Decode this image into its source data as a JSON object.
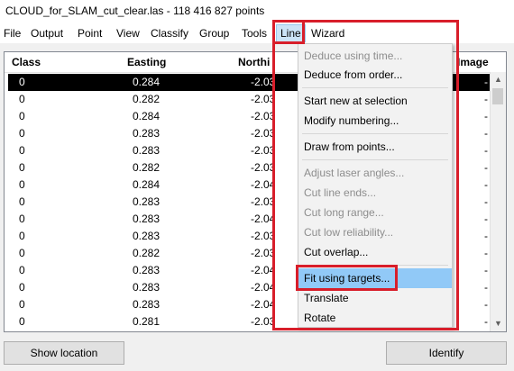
{
  "window": {
    "title": "CLOUD_for_SLAM_cut_clear.las - 118 416 827 points"
  },
  "menubar": [
    "File",
    "Output",
    "Point",
    "View",
    "Classify",
    "Group",
    "Tools",
    "Line",
    "Wizard"
  ],
  "table": {
    "columns": [
      "Class",
      "Easting",
      "Northi",
      "Image"
    ],
    "rows": [
      {
        "class": "0",
        "easting": "0.284",
        "northing": "-2.03",
        "image": "-"
      },
      {
        "class": "0",
        "easting": "0.282",
        "northing": "-2.03",
        "image": "-"
      },
      {
        "class": "0",
        "easting": "0.284",
        "northing": "-2.03",
        "image": "-"
      },
      {
        "class": "0",
        "easting": "0.283",
        "northing": "-2.03",
        "image": "-"
      },
      {
        "class": "0",
        "easting": "0.283",
        "northing": "-2.03",
        "image": "-"
      },
      {
        "class": "0",
        "easting": "0.282",
        "northing": "-2.03",
        "image": "-"
      },
      {
        "class": "0",
        "easting": "0.284",
        "northing": "-2.04",
        "image": "-"
      },
      {
        "class": "0",
        "easting": "0.283",
        "northing": "-2.03",
        "image": "-"
      },
      {
        "class": "0",
        "easting": "0.283",
        "northing": "-2.04",
        "image": "-"
      },
      {
        "class": "0",
        "easting": "0.283",
        "northing": "-2.03",
        "image": "-"
      },
      {
        "class": "0",
        "easting": "0.282",
        "northing": "-2.03",
        "image": "-"
      },
      {
        "class": "0",
        "easting": "0.283",
        "northing": "-2.04",
        "image": "-"
      },
      {
        "class": "0",
        "easting": "0.283",
        "northing": "-2.04",
        "image": "-"
      },
      {
        "class": "0",
        "easting": "0.283",
        "northing": "-2.04",
        "image": "-"
      },
      {
        "class": "0",
        "easting": "0.281",
        "northing": "-2.03",
        "image": "-"
      }
    ]
  },
  "buttons": {
    "show_location": "Show location",
    "identify": "Identify"
  },
  "line_menu": {
    "items": [
      {
        "label": "Deduce using time...",
        "disabled": true
      },
      {
        "label": "Deduce from order...",
        "disabled": false
      },
      {
        "label": "Start new at selection",
        "disabled": false
      },
      {
        "label": "Modify numbering...",
        "disabled": false
      },
      {
        "label": "Draw from points...",
        "disabled": false
      },
      {
        "label": "Adjust laser angles...",
        "disabled": true
      },
      {
        "label": "Cut line ends...",
        "disabled": true
      },
      {
        "label": "Cut long range...",
        "disabled": true
      },
      {
        "label": "Cut low reliability...",
        "disabled": true
      },
      {
        "label": "Cut overlap...",
        "disabled": false
      },
      {
        "label": "Fit using targets...",
        "disabled": false,
        "hover": true
      },
      {
        "label": "Translate",
        "disabled": false
      },
      {
        "label": "Rotate",
        "disabled": false
      }
    ]
  },
  "colors": {
    "highlight_red": "#d81e2a",
    "hover_blue": "#91c9f7",
    "selected_row": "#000000"
  }
}
